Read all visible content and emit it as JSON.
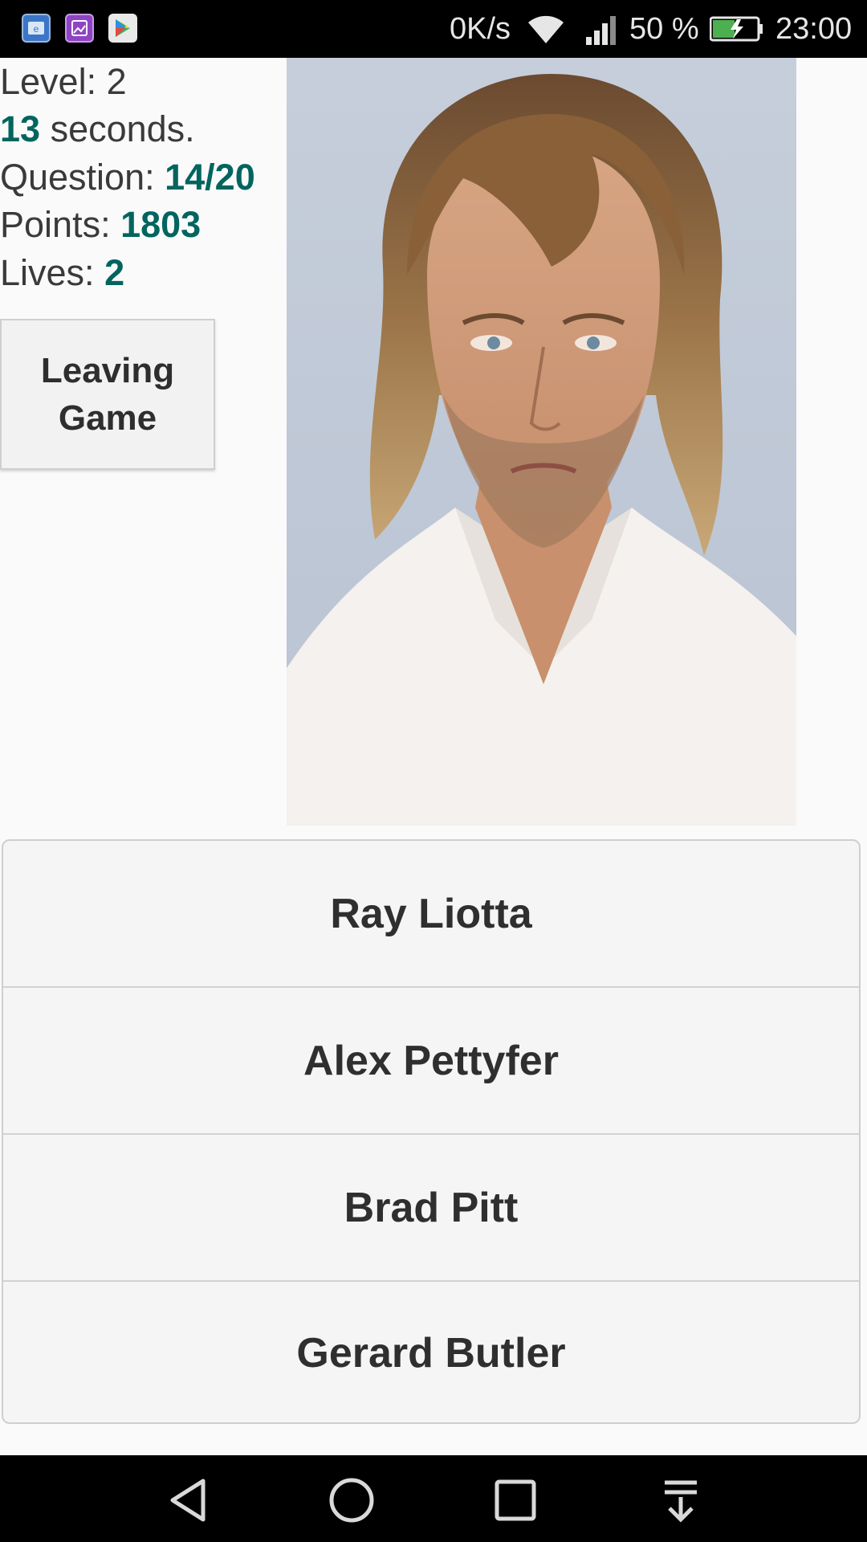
{
  "status_bar": {
    "speed": "0K/s",
    "battery_percent": "50 %",
    "time": "23:00",
    "battery_level": 0.5,
    "app_icons": [
      "browser-app-icon",
      "gallery-app-icon",
      "play-store-icon"
    ]
  },
  "game": {
    "level_label": "Level: ",
    "level_value": "2",
    "seconds_value": "13",
    "seconds_label": " seconds.",
    "question_label": "Question: ",
    "question_value": "14/20",
    "points_label": "Points: ",
    "points_value": "1803",
    "lives_label": "Lives: ",
    "lives_value": "2",
    "leave_button": "Leaving Game"
  },
  "answers": [
    "Ray Liotta",
    "Alex Pettyfer",
    "Brad Pitt",
    "Gerard Butler"
  ],
  "colors": {
    "accent": "#00655e",
    "text": "#3a3a3a",
    "background": "#fafafa"
  }
}
